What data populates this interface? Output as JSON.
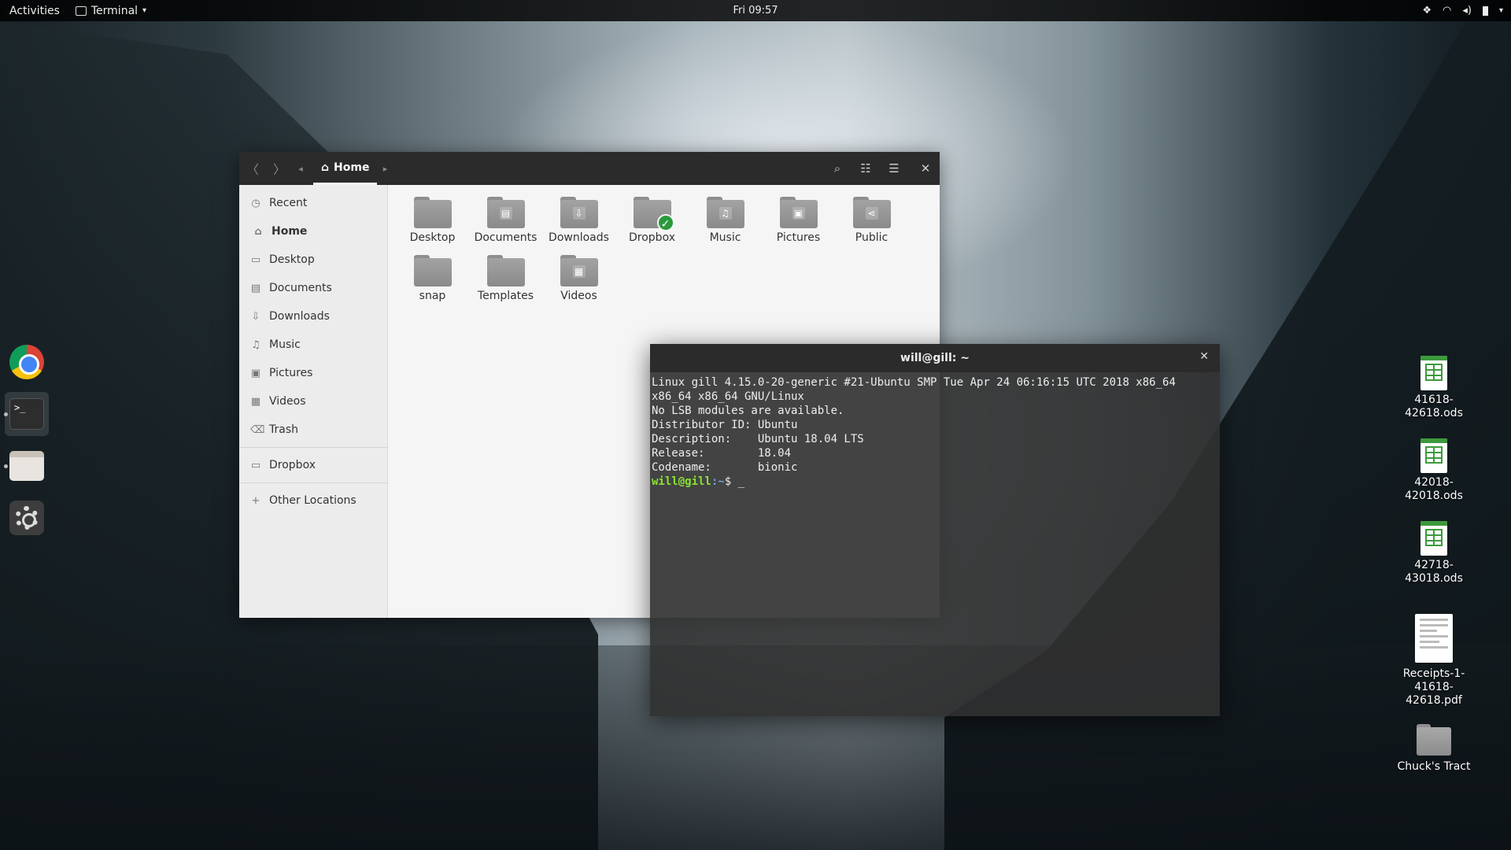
{
  "topbar": {
    "activities": "Activities",
    "app_name": "Terminal",
    "clock": "Fri 09:57"
  },
  "dock": {
    "items": [
      {
        "name": "chrome",
        "icon": "chrome-icon"
      },
      {
        "name": "terminal",
        "icon": "terminal-icon",
        "glyph": ">_"
      },
      {
        "name": "files",
        "icon": "files-icon"
      },
      {
        "name": "settings",
        "icon": "settings-icon"
      }
    ]
  },
  "nautilus": {
    "breadcrumb": "Home",
    "sidebar": {
      "items": [
        {
          "label": "Recent",
          "icon": "clock-icon"
        },
        {
          "label": "Home",
          "icon": "home-icon"
        },
        {
          "label": "Desktop",
          "icon": "desktop-icon"
        },
        {
          "label": "Documents",
          "icon": "document-icon"
        },
        {
          "label": "Downloads",
          "icon": "download-icon"
        },
        {
          "label": "Music",
          "icon": "music-icon"
        },
        {
          "label": "Pictures",
          "icon": "picture-icon"
        },
        {
          "label": "Videos",
          "icon": "video-icon"
        },
        {
          "label": "Trash",
          "icon": "trash-icon"
        },
        {
          "label": "Dropbox",
          "icon": "folder-icon"
        },
        {
          "label": "Other Locations",
          "icon": "plus-icon"
        }
      ]
    },
    "files": [
      {
        "label": "Desktop",
        "glyph": ""
      },
      {
        "label": "Documents",
        "glyph": "▤"
      },
      {
        "label": "Downloads",
        "glyph": "⇩"
      },
      {
        "label": "Dropbox",
        "glyph": ""
      },
      {
        "label": "Music",
        "glyph": "♫"
      },
      {
        "label": "Pictures",
        "glyph": "▣"
      },
      {
        "label": "Public",
        "glyph": "⋖"
      },
      {
        "label": "snap",
        "glyph": ""
      },
      {
        "label": "Templates",
        "glyph": ""
      },
      {
        "label": "Videos",
        "glyph": "▦"
      }
    ]
  },
  "terminal": {
    "title": "will@gill: ~",
    "lines": [
      "Linux gill 4.15.0-20-generic #21-Ubuntu SMP Tue Apr 24 06:16:15 UTC 2018 x86_64",
      "x86_64 x86_64 GNU/Linux",
      "No LSB modules are available.",
      "Distributor ID: Ubuntu",
      "Description:    Ubuntu 18.04 LTS",
      "Release:        18.04",
      "Codename:       bionic"
    ],
    "prompt_user": "will@gill",
    "prompt_path": ":~",
    "prompt_tail": "$ _"
  },
  "desktop": {
    "items": [
      {
        "label": "41618-42618.ods",
        "type": "ods"
      },
      {
        "label": "42018-42018.ods",
        "type": "ods"
      },
      {
        "label": "42718-43018.ods",
        "type": "ods"
      },
      {
        "label": "Receipts-1-41618-42618.pdf",
        "type": "pdf"
      },
      {
        "label": "Chuck's Tract",
        "type": "folder"
      }
    ]
  },
  "colors": {
    "prompt_user": "#8ae234",
    "prompt_path": "#729fcf",
    "dropbox_check": "#2b9a3b"
  }
}
